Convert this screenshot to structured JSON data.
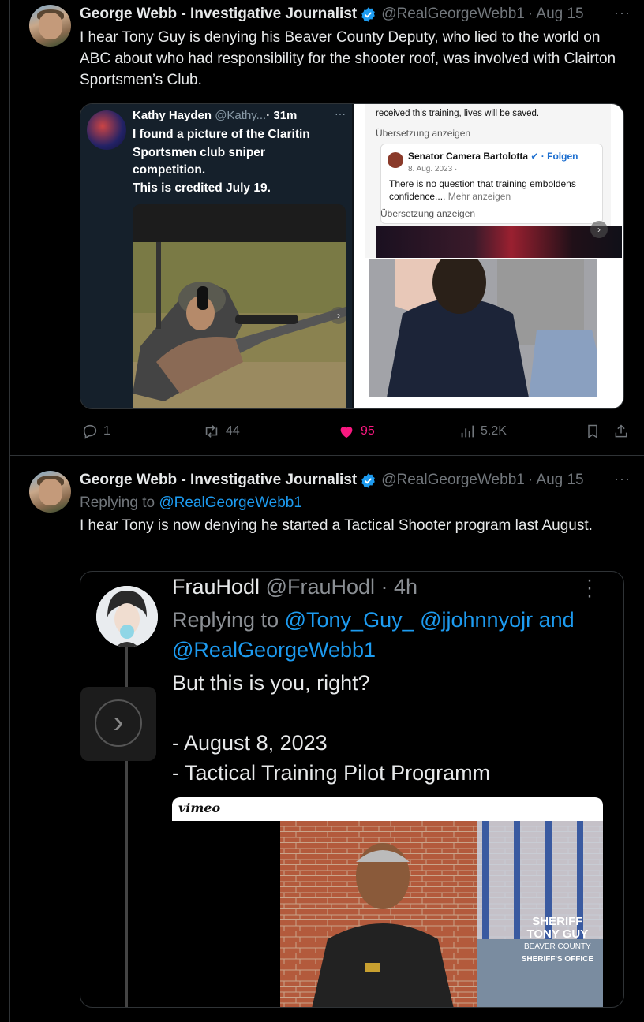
{
  "posts": [
    {
      "author_name": "George Webb - Investigative Journalist",
      "handle": "@RealGeorgeWebb1",
      "date": "· Aug 15",
      "more": "···",
      "text": "I hear Tony Guy is denying his Beaver County Deputy, who lied to the world on ABC about who had responsibility for the shooter roof, was involved with Clairton Sportsmen’s Club.",
      "media": {
        "quoted_left": {
          "name": "Kathy Hayden",
          "handle": "@Kathy...",
          "time": "· 31m",
          "more": "···",
          "text_lines": [
            "I found a picture of the Claritin",
            "Sportsmen club sniper",
            "competition.",
            "This is credited July 19."
          ]
        },
        "quoted_right": {
          "top_text": "received this training, lives will be saved.",
          "translate1": "Übersetzung anzeigen",
          "card_name": "Senator Camera Bartolotta",
          "card_follow": "· Folgen",
          "card_date": "8. Aug. 2023 ·",
          "card_text": "There is no question that training emboldens confidence....",
          "card_more": "Mehr anzeigen",
          "translate2": "Übersetzung anzeigen"
        }
      },
      "actions": {
        "replies": "1",
        "reposts": "44",
        "likes": "95",
        "views": "5.2K"
      }
    },
    {
      "author_name": "George Webb - Investigative Journalist",
      "handle": "@RealGeorgeWebb1",
      "date": "· Aug 15",
      "more": "···",
      "replying_label": "Replying to",
      "replying_handle": "@RealGeorgeWebb1",
      "text": "I hear Tony is now denying he started a Tactical Shooter program last August.",
      "media": {
        "name": "FrauHodl",
        "handle": "@FrauHodl",
        "time": "· 4h",
        "replying_label": "Replying to",
        "replying_handles": "@Tony_Guy_ @jjohnnyojr",
        "replying_and": "and",
        "replying_handle2": "@RealGeorgeWebb1",
        "body_lines": [
          "But this is you, right?",
          "",
          "- August 8, 2023",
          "- Tactical Training Pilot Programm"
        ],
        "video_brand": "vimeo",
        "overlay": {
          "line1": "SHERIFF",
          "line2": "TONY GUY",
          "line3": "BEAVER COUNTY",
          "line4": "SHERIFF'S OFFICE"
        },
        "arrow": "›"
      }
    }
  ],
  "colors": {
    "background": "#000000",
    "text": "#e7e9ea",
    "muted": "#71767b",
    "link": "#1d9bf0",
    "like": "#f91880",
    "verified": "#1d9bf0"
  },
  "icons": [
    "verified-badge-icon",
    "reply-icon",
    "repost-icon",
    "like-icon",
    "views-icon",
    "bookmark-icon",
    "share-icon",
    "chevron-right-icon"
  ]
}
